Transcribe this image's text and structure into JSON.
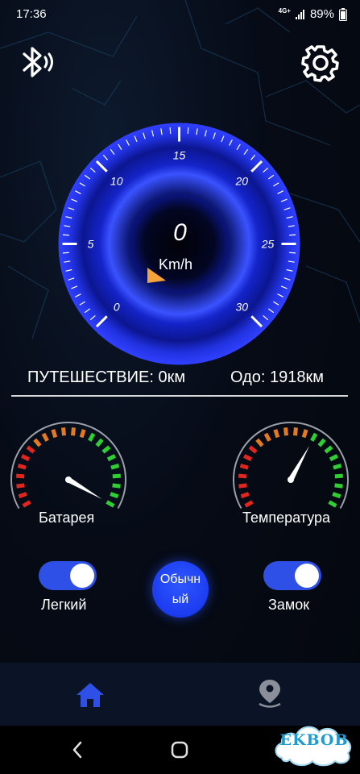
{
  "status_bar": {
    "time": "17:36",
    "network": "4G+",
    "battery": "89%",
    "icons": [
      "signal-icon",
      "battery-icon"
    ]
  },
  "header": {
    "bluetooth_icon": "bluetooth-icon",
    "settings_icon": "gear-icon"
  },
  "speedometer": {
    "speed": "0",
    "unit": "Km/h",
    "scale_labels": [
      "0",
      "5",
      "10",
      "15",
      "20",
      "25",
      "30"
    ],
    "scale_min": 0,
    "scale_max": 30,
    "current_value": 0,
    "accent_color": "#2a3cf0",
    "pointer_color": "#f2a33a"
  },
  "trip": {
    "trip_label": "ПУТЕШЕСТВИЕ: 0км",
    "odo_label": "Одо: 1918км"
  },
  "gauges": {
    "battery_label": "Батарея",
    "temperature_label": "Температура",
    "battery_level": 1.0,
    "temperature_level": 0.62,
    "colors": {
      "low": "#e0261f",
      "mid": "#e37a1f",
      "high": "#2fcf34"
    }
  },
  "controls": {
    "light_label": "Легкий",
    "light_on": true,
    "mode_label": "Обычный",
    "lock_label": "Замок",
    "lock_on": true,
    "toggle_color": "#2f50e6"
  },
  "bottom_nav": {
    "items": [
      "home-icon",
      "location-pin-icon"
    ],
    "active_color": "#2f50e6",
    "inactive_color": "#8a8f99"
  },
  "system_nav": {
    "items": [
      "back-icon",
      "home-circle-icon"
    ]
  },
  "watermark": {
    "text": "EKBOB"
  }
}
